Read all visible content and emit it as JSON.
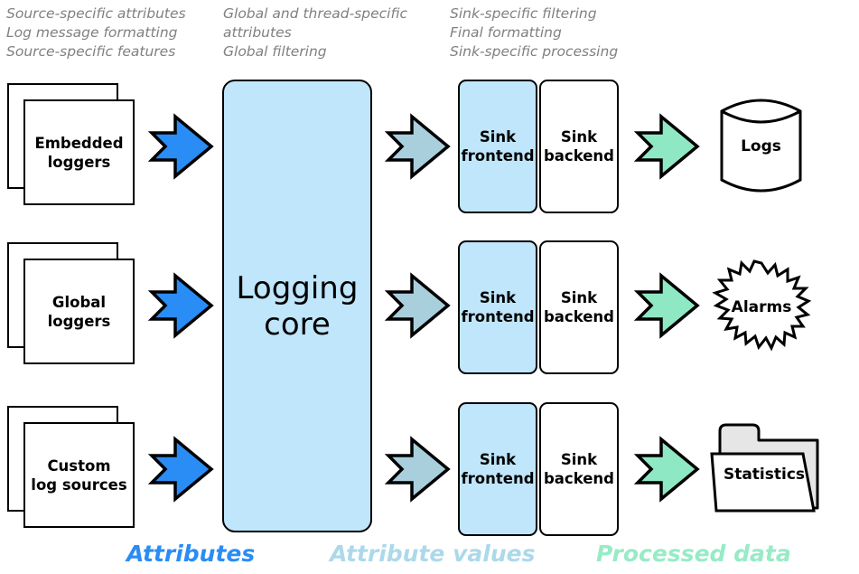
{
  "captions": {
    "sources": "Source-specific attributes\nLog message formatting\nSource-specific features",
    "core": "Global and thread-specific\nattributes\nGlobal filtering",
    "sinks": "Sink-specific filtering\nFinal formatting\nSink-specific processing"
  },
  "sources": [
    {
      "label": "Embedded\nloggers"
    },
    {
      "label": "Global\nloggers"
    },
    {
      "label": "Custom\nlog sources"
    }
  ],
  "core": {
    "label": "Logging\ncore"
  },
  "sinks": [
    {
      "frontend": "Sink\nfrontend",
      "backend": "Sink\nbackend"
    },
    {
      "frontend": "Sink\nfrontend",
      "backend": "Sink\nbackend"
    },
    {
      "frontend": "Sink\nfrontend",
      "backend": "Sink\nbackend"
    }
  ],
  "outputs": [
    {
      "label": "Logs",
      "shape": "cylinder"
    },
    {
      "label": "Alarms",
      "shape": "starburst"
    },
    {
      "label": "Statistics",
      "shape": "folder"
    }
  ],
  "legend": [
    {
      "label": "Attributes",
      "color": "#2a8cf5"
    },
    {
      "label": "Attribute values",
      "color": "#acd9ea"
    },
    {
      "label": "Processed data",
      "color": "#97ebc6"
    }
  ],
  "colors": {
    "attributes_arrow": "#2a8cf5",
    "attribute_values_arrow": "#a9cfdd",
    "processed_data_arrow": "#8fe8c4",
    "core_fill": "#bfe6fb",
    "sink_frontend_fill": "#bfe6fb",
    "sink_backend_fill": "#ffffff",
    "caption_text": "#808080",
    "outline": "#000000",
    "folder_back": "#e6e6e6"
  }
}
